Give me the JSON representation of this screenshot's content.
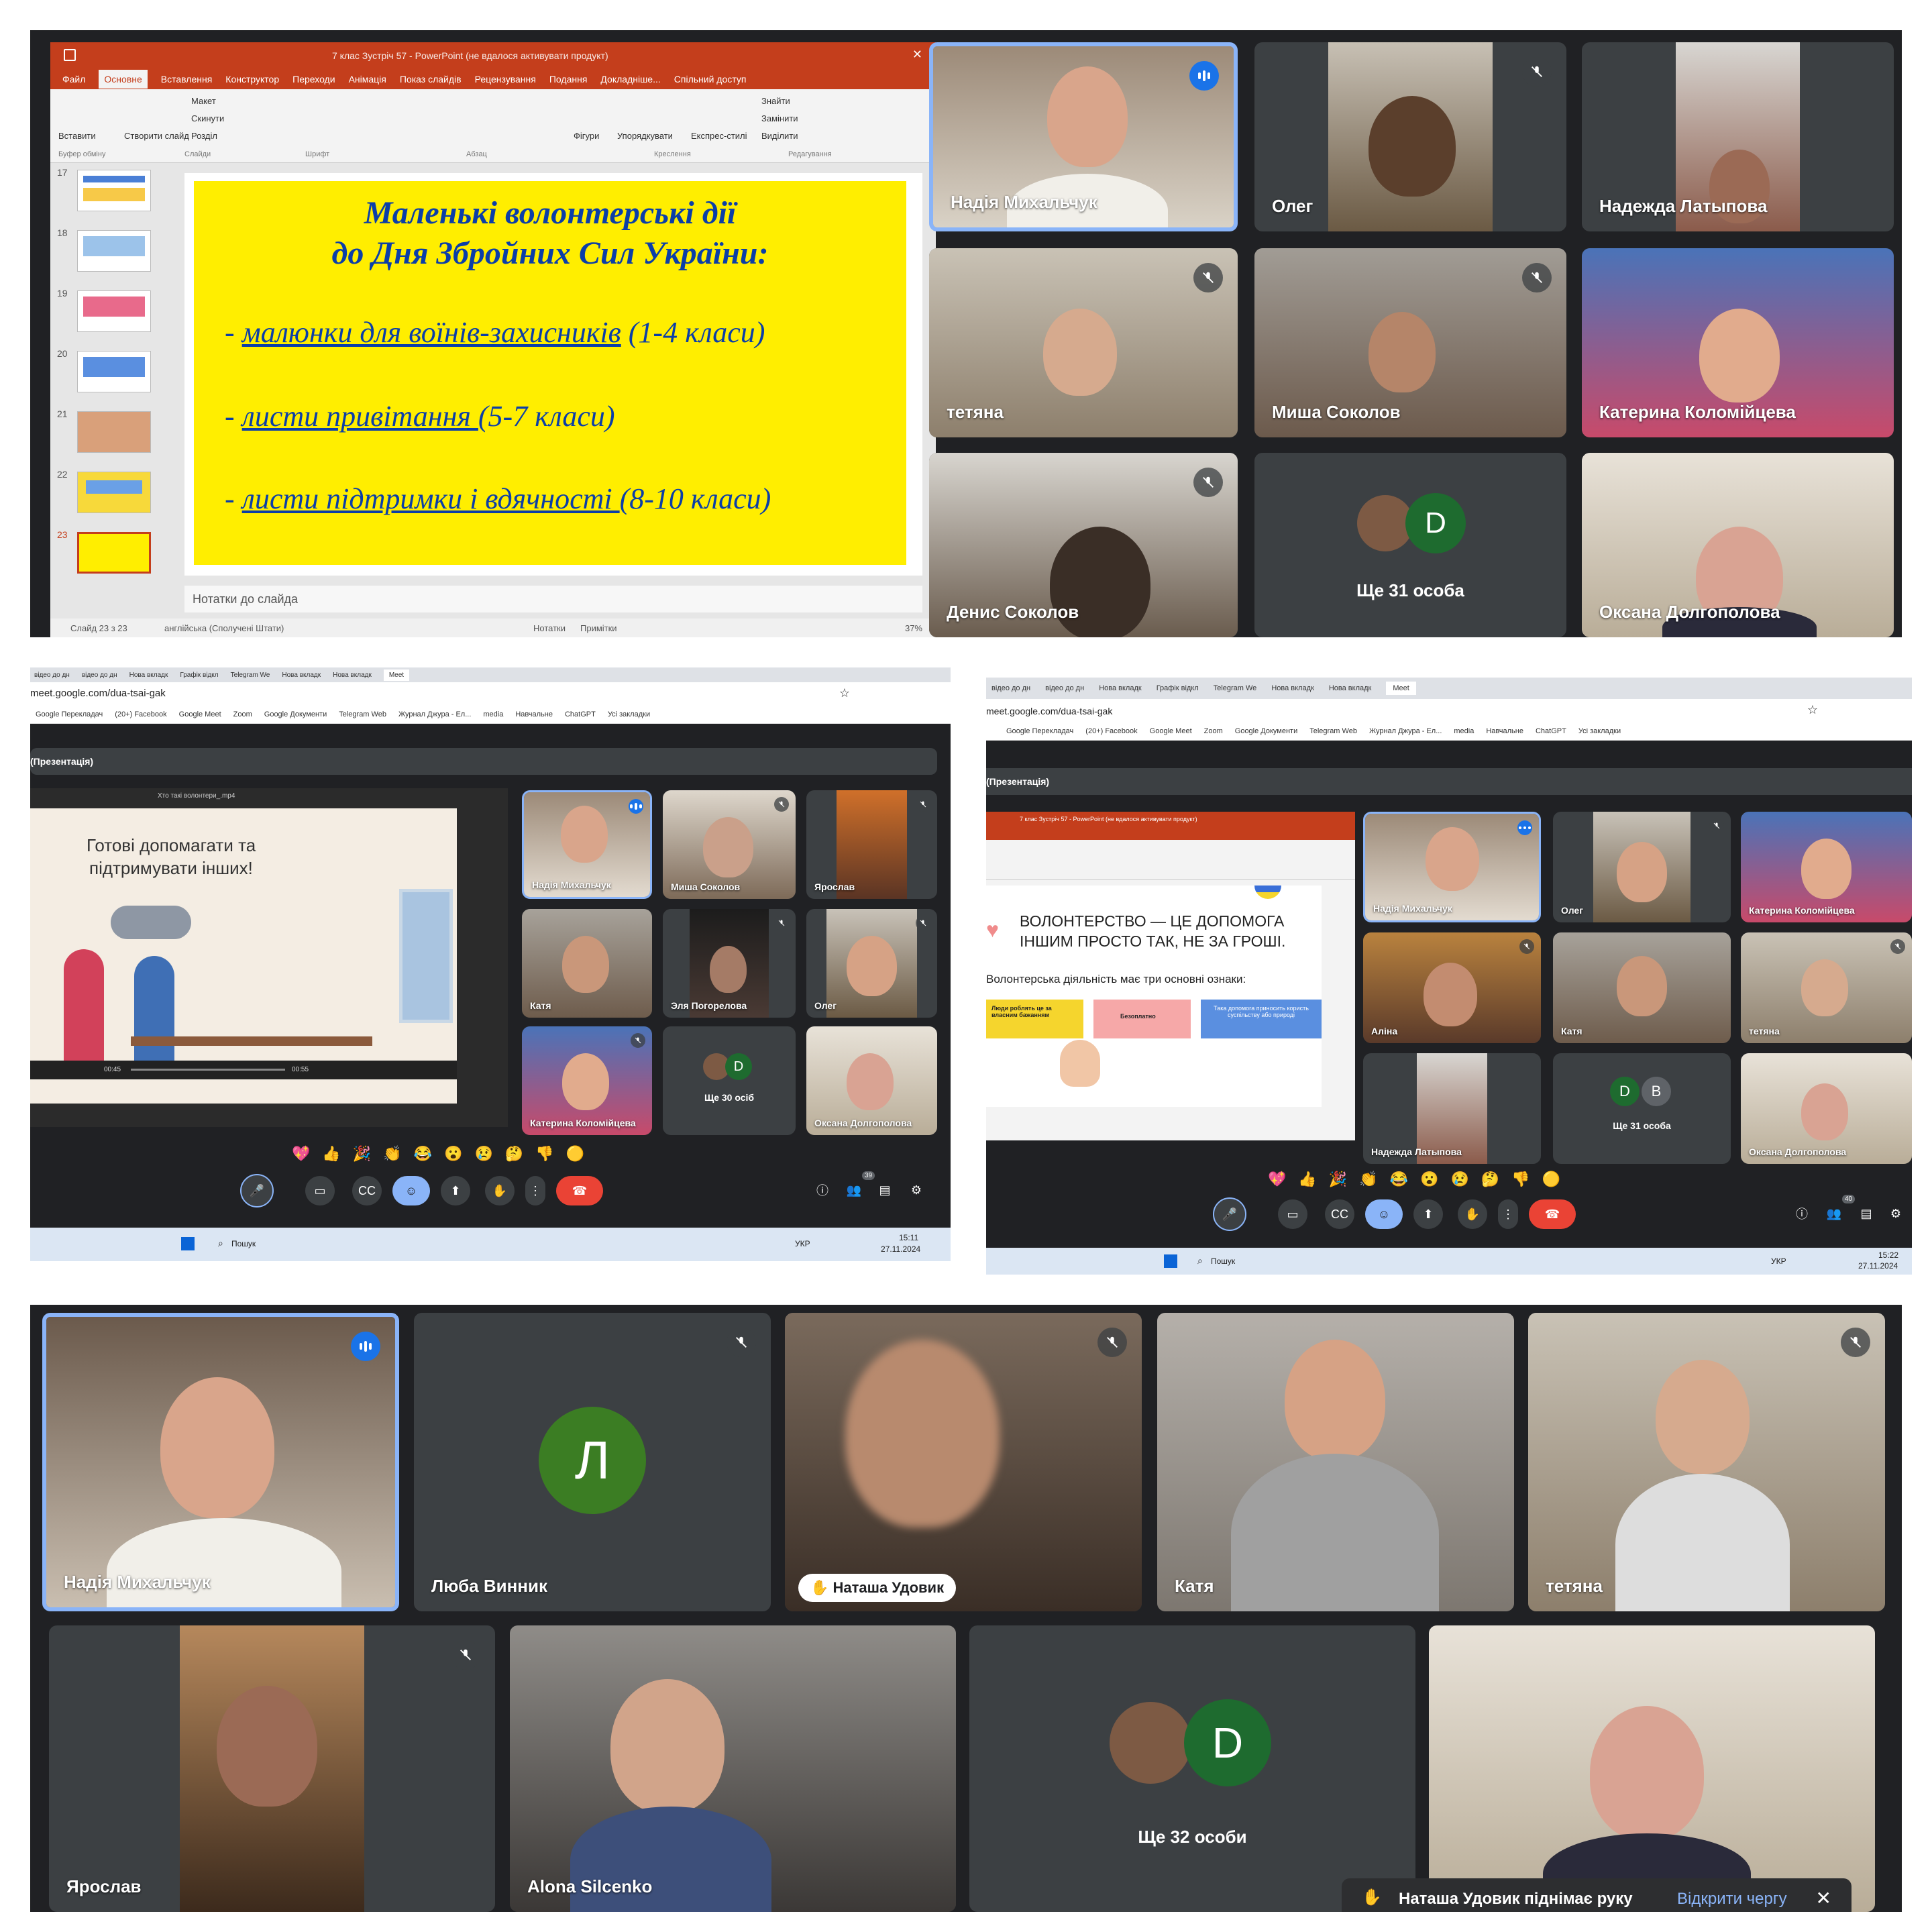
{
  "panel1": {
    "ppt": {
      "title": "7 клас Зустріч 57 - PowerPoint (не вдалося активувати продукт)",
      "ribbon_tabs": [
        "Файл",
        "Основне",
        "Вставлення",
        "Конструктор",
        "Переходи",
        "Анімація",
        "Показ слайдів",
        "Рецензування",
        "Подання",
        "Докладніше...",
        "Спільний доступ"
      ],
      "ribbon_groups": [
        "Буфер обміну",
        "Слайди",
        "Шрифт",
        "Абзац",
        "Креслення",
        "Редагування"
      ],
      "ribbon_btns": [
        "Вставити",
        "Створити слайд",
        "Макет",
        "Скинути",
        "Розділ",
        "Фігури",
        "Упорядкувати",
        "Експрес-стилі",
        "Знайти",
        "Замінити",
        "Виділити"
      ],
      "thumb_numbers": [
        "17",
        "18",
        "19",
        "20",
        "21",
        "22",
        "23"
      ],
      "slide_title_1": "Маленькі волонтерські дії",
      "slide_title_2": "до Дня Збройних Сил України:",
      "bullets": [
        {
          "link": "малюнки для воїнів-захисників",
          "rest": " (1-4 класи)"
        },
        {
          "link": "листи привітання ",
          "rest": "(5-7 класи)"
        },
        {
          "link": "листи підтримки і вдячності ",
          "rest": "(8-10 класи)"
        }
      ],
      "notes": "Нотатки до слайда",
      "status_left": "Слайд 23 з 23",
      "status_lang": "англійська (Сполучені Штати)",
      "status_notes": "Нотатки",
      "status_comments": "Примітки",
      "zoom": "37%"
    },
    "tiles": [
      {
        "name": "Надія Михальчук"
      },
      {
        "name": "Олег"
      },
      {
        "name": "Надежда Латыпова"
      },
      {
        "name": "тетяна"
      },
      {
        "name": "Миша Соколов"
      },
      {
        "name": "Катерина Коломійцева"
      },
      {
        "name": "Денис Соколов"
      },
      {
        "name": "Ще 31 особа",
        "letter": "D"
      },
      {
        "name": "Оксана Долгополова"
      }
    ]
  },
  "panel2": {
    "tabs": [
      "відео до дн",
      "відео до дн",
      "Нова вкладк",
      "Графік відкл",
      "Telegram We",
      "Нова вкладк",
      "Нова вкладк",
      "Meet"
    ],
    "url": "meet.google.com/dua-tsai-gak",
    "bookmarks": [
      "Google Перекладач",
      "(20+) Facebook",
      "Google Meet",
      "Zoom",
      "Google Документи",
      "Telegram Web",
      "Журнал Джура - Ел...",
      "media",
      "Навчальне",
      "ChatGPT",
      "Усі закладки"
    ],
    "presenting": "(Презентація)",
    "video_title": "Хто такі волонтери_.mp4",
    "video_text_1": "Готові допомагати та",
    "video_text_2": "підтримувати інших!",
    "video_time_1": "00:45",
    "video_time_2": "00:55",
    "tiles": [
      {
        "name": "Надія Михальчук"
      },
      {
        "name": "Миша Соколов"
      },
      {
        "name": "Ярослав"
      },
      {
        "name": "Катя"
      },
      {
        "name": "Эля Погорелова"
      },
      {
        "name": "Олег"
      },
      {
        "name": "Катерина Коломійцева"
      },
      {
        "name": "Ще 30 осіб",
        "letter": "D"
      },
      {
        "name": "Оксана Долгополова"
      }
    ],
    "reactions": [
      "💖",
      "👍",
      "🎉",
      "👏",
      "😂",
      "😮",
      "😢",
      "🤔",
      "👎",
      "🟡"
    ],
    "participants": "39",
    "search": "Пошук",
    "lang": "УКР",
    "time": "15:11",
    "date": "27.11.2024"
  },
  "panel3": {
    "tabs": [
      "відео до дн",
      "відео до дн",
      "Нова вкладк",
      "Графік відкл",
      "Telegram We",
      "Нова вкладк",
      "Нова вкладк",
      "Meet"
    ],
    "url": "meet.google.com/dua-tsai-gak",
    "bookmarks": [
      "Google Перекладач",
      "(20+) Facebook",
      "Google Meet",
      "Zoom",
      "Google Документи",
      "Telegram Web",
      "Журнал Джура - Ел...",
      "media",
      "Навчальне",
      "ChatGPT",
      "Усі закладки"
    ],
    "presenting": "(Презентація)",
    "ppt_title": "7 клас Зустріч 57 - PowerPoint (не вдалося активувати продукт)",
    "slide_heading_1": "ВОЛОНТЕРСТВО — ЦЕ ДОПОМОГА",
    "slide_heading_2": "ІНШИМ ПРОСТО ТАК, НЕ ЗА ГРОШІ.",
    "slide_sub": "Волонтерська діяльність має три основні ознаки:",
    "box1": "Люди роблять це за власним бажанням",
    "box2": "Безоплатно",
    "box3": "Така допомога приносить користь суспільству або природі",
    "tiles": [
      {
        "name": "Надія Михальчук"
      },
      {
        "name": "Олег"
      },
      {
        "name": "Катерина Коломійцева"
      },
      {
        "name": "Аліна"
      },
      {
        "name": "Катя"
      },
      {
        "name": "тетяна"
      },
      {
        "name": "Надежда Латыпова"
      },
      {
        "name": "Ще 31 особа",
        "letter": "D",
        "letter2": "B"
      },
      {
        "name": "Оксана Долгополова"
      }
    ],
    "reactions": [
      "💖",
      "👍",
      "🎉",
      "👏",
      "😂",
      "😮",
      "😢",
      "🤔",
      "👎",
      "🟡"
    ],
    "participants": "40",
    "search": "Пошук",
    "lang": "УКР",
    "time": "15:22",
    "date": "27.11.2024"
  },
  "panel4": {
    "tiles": [
      {
        "name": "Надія Михальчук"
      },
      {
        "name": "Люба Винник",
        "letter": "Л"
      },
      {
        "name": "Наташа Удовик"
      },
      {
        "name": "Катя"
      },
      {
        "name": "тетяна"
      },
      {
        "name": "Ярослав"
      },
      {
        "name": "Alona Silcenko"
      },
      {
        "name": "Ще 32 особи",
        "letter": "D"
      },
      {
        "name": ""
      }
    ],
    "toast_text": "Наташа Удовик піднімає руку",
    "toast_action": "Відкрити чергу"
  },
  "colors": {
    "meet_bg": "#202124",
    "tile_bg": "#3c4043",
    "active_border": "#8ab4f8",
    "speaking_blue": "#1a73e8",
    "avatar_green": "#3b7d23",
    "avatar_dark_green": "#1e6b2f",
    "ppt_red": "#c43e1c",
    "slide_yellow": "#ffee00",
    "end_call_red": "#ea4335"
  },
  "icons": [
    "mic-off-icon",
    "speaking-icon",
    "mic-icon",
    "camera-icon",
    "captions-icon",
    "emoji-icon",
    "present-icon",
    "hand-icon",
    "more-icon",
    "end-call-icon",
    "info-icon",
    "people-icon",
    "chat-icon",
    "activities-icon",
    "search-icon",
    "star-icon",
    "hand-raise-icon",
    "close-icon"
  ]
}
